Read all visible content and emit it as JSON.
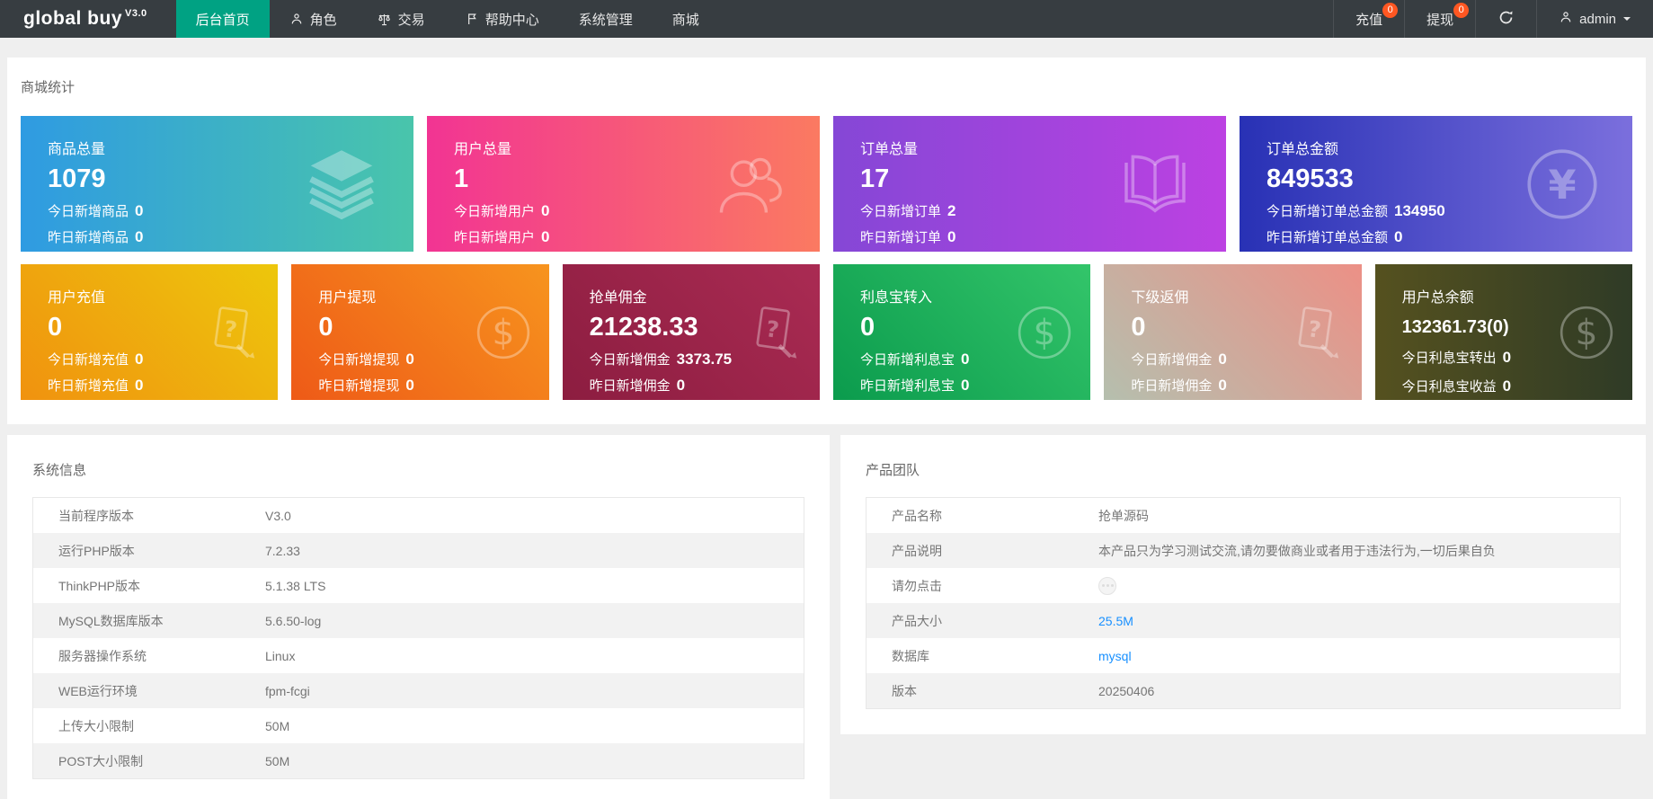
{
  "colors": {
    "navbar": "#373d41",
    "accent": "#00a283",
    "badge": "#ff5722",
    "link": "#1890ff"
  },
  "navbar": {
    "logo": "global buy",
    "logo_version": "V3.0",
    "items": [
      {
        "label": "后台首页",
        "icon": "",
        "active": true
      },
      {
        "label": "角色",
        "icon": "person-icon",
        "active": false
      },
      {
        "label": "交易",
        "icon": "scales-icon",
        "active": false
      },
      {
        "label": "帮助中心",
        "icon": "flag-icon",
        "active": false
      },
      {
        "label": "系统管理",
        "icon": "",
        "active": false
      },
      {
        "label": "商城",
        "icon": "",
        "active": false
      }
    ],
    "right": {
      "recharge_label": "充值",
      "recharge_badge": "0",
      "withdraw_label": "提现",
      "withdraw_badge": "0",
      "refresh_icon": "refresh-icon",
      "username": "admin"
    }
  },
  "stats_panel": {
    "title": "商城统计",
    "row1": [
      {
        "title": "商品总量",
        "value": "1079",
        "line1_label": "今日新增商品",
        "line1_value": "0",
        "line2_label": "昨日新增商品",
        "line2_value": "0",
        "icon": "layers-icon",
        "gradient": {
          "angle": "to right",
          "from": "#2f9be2",
          "to": "#49c5ab"
        }
      },
      {
        "title": "用户总量",
        "value": "1",
        "line1_label": "今日新增用户",
        "line1_value": "0",
        "line2_label": "昨日新增用户",
        "line2_value": "0",
        "icon": "users-icon",
        "gradient": {
          "angle": "to right",
          "from": "#f23493",
          "to": "#fb7a61"
        }
      },
      {
        "title": "订单总量",
        "value": "17",
        "line1_label": "今日新增订单",
        "line1_value": "2",
        "line2_label": "昨日新增订单",
        "line2_value": "0",
        "icon": "book-open-icon",
        "gradient": {
          "angle": "to right",
          "from": "#8547d6",
          "to": "#bc41e2"
        }
      },
      {
        "title": "订单总金额",
        "value": "849533",
        "line1_label": "今日新增订单总金额",
        "line1_value": "134950",
        "line2_label": "昨日新增订单总金额",
        "line2_value": "0",
        "icon": "yen-circle-icon",
        "gradient": {
          "angle": "to right",
          "from": "#2831b5",
          "to": "#7b6fdd"
        }
      }
    ],
    "row2": [
      {
        "title": "用户充值",
        "value": "0",
        "line1_label": "今日新增充值",
        "line1_value": "0",
        "line2_label": "昨日新增充值",
        "line2_value": "0",
        "icon": "doc-question-icon",
        "gradient": {
          "angle": "45deg",
          "from": "#f0920f",
          "to": "#edc70c"
        }
      },
      {
        "title": "用户提现",
        "value": "0",
        "line1_label": "今日新增提现",
        "line1_value": "0",
        "line2_label": "昨日新增提现",
        "line2_value": "0",
        "icon": "dollar-circle-icon",
        "gradient": {
          "angle": "45deg",
          "from": "#ee5a17",
          "to": "#f7941e"
        }
      },
      {
        "title": "抢单佣金",
        "value": "21238.33",
        "line1_label": "今日新增佣金",
        "line1_value": "3373.75",
        "line2_label": "昨日新增佣金",
        "line2_value": "0",
        "icon": "doc-question-icon",
        "gradient": {
          "angle": "45deg",
          "from": "#8c1d40",
          "to": "#aa2b53"
        }
      },
      {
        "title": "利息宝转入",
        "value": "0",
        "line1_label": "今日新增利息宝",
        "line1_value": "0",
        "line2_label": "昨日新增利息宝",
        "line2_value": "0",
        "icon": "dollar-circle-icon",
        "gradient": {
          "angle": "45deg",
          "from": "#0b9b4d",
          "to": "#33c56a"
        }
      },
      {
        "title": "下级返佣",
        "value": "0",
        "line1_label": "今日新增佣金",
        "line1_value": "0",
        "line2_label": "昨日新增佣金",
        "line2_value": "0",
        "icon": "doc-question-icon",
        "gradient": {
          "angle": "45deg",
          "from": "#b5bfae",
          "to": "#ec9086"
        }
      },
      {
        "title": "用户总余额",
        "value": "132361.73(0)",
        "line1_label": "今日利息宝转出",
        "line1_value": "0",
        "line2_label": "今日利息宝收益",
        "line2_value": "0",
        "icon": "dollar-circle-icon",
        "gradient": {
          "angle": "to right",
          "from": "#55511f",
          "to": "#2f3b26"
        }
      }
    ]
  },
  "system_info": {
    "title": "系统信息",
    "rows": [
      {
        "label": "当前程序版本",
        "value": "V3.0"
      },
      {
        "label": "运行PHP版本",
        "value": "7.2.33"
      },
      {
        "label": "ThinkPHP版本",
        "value": "5.1.38 LTS"
      },
      {
        "label": "MySQL数据库版本",
        "value": "5.6.50-log"
      },
      {
        "label": "服务器操作系统",
        "value": "Linux"
      },
      {
        "label": "WEB运行环境",
        "value": "fpm-fcgi"
      },
      {
        "label": "上传大小限制",
        "value": "50M"
      },
      {
        "label": "POST大小限制",
        "value": "50M"
      }
    ]
  },
  "product_team": {
    "title": "产品团队",
    "rows": [
      {
        "label": "产品名称",
        "value": "抢单源码"
      },
      {
        "label": "产品说明",
        "value": "本产品只为学习测试交流,请勿要做商业或者用于违法行为,一切后果自负"
      },
      {
        "label": "请勿点击",
        "value": "",
        "icon": "do-not-click-icon"
      },
      {
        "label": "产品大小",
        "value": "25.5M",
        "link": true
      },
      {
        "label": "数据库",
        "value": "mysql",
        "link": true
      },
      {
        "label": "版本",
        "value": "20250406"
      }
    ]
  }
}
